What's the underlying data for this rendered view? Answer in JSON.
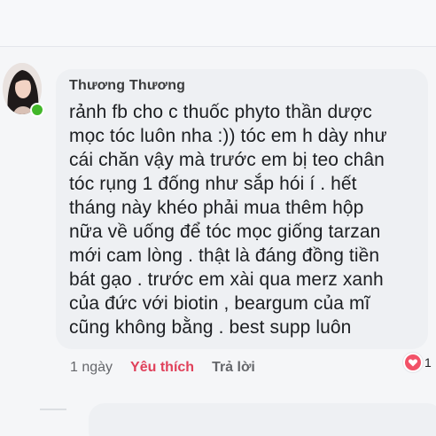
{
  "comment": {
    "author": "Thương Thương",
    "text": "rảnh fb cho c thuốc phyto thần dược\nmọc tóc luôn nha :)) tóc em h dày như\ncái chăn vậy mà trước em bị teo chân\ntóc rụng 1 đống như sắp hói í . hết\ntháng này khéo phải mua thêm hộp\nnữa về uống để tóc mọc giống tarzan\nmới cam lòng . thật là đáng đồng tiền\nbát gạo . trước em xài qua merz xanh\ncủa đức với biotin , beargum của mĩ\ncũng không bằng . best supp luôn",
    "time": "1 ngày",
    "like_label": "Yêu thích",
    "reply_label": "Trả lời",
    "reaction_count": "1",
    "reaction_type": "love-reaction-icon",
    "online": true
  },
  "colors": {
    "like_active": "#e0415b",
    "online": "#42b72a",
    "bubble": "#eef0f3"
  }
}
